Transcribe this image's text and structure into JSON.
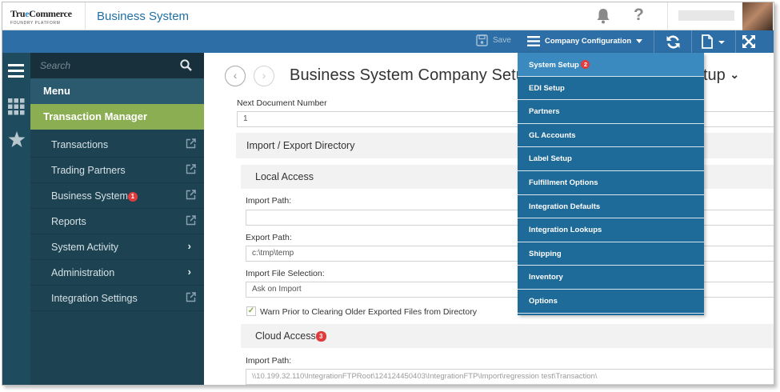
{
  "header": {
    "logo_line1_a": "Tru",
    "logo_line1_o": "e",
    "logo_line1_b": "Commerce",
    "logo_line2": "FOUNDRY PLATFORM",
    "app_title": "Business System"
  },
  "toolbar": {
    "save_label": "Save",
    "company_config_label": "Company Configuration"
  },
  "sidebar": {
    "search_placeholder": "Search",
    "menu_label": "Menu",
    "section_label": "Transaction Manager",
    "items": [
      {
        "label": "Transactions",
        "kind": "external"
      },
      {
        "label": "Trading Partners",
        "kind": "external"
      },
      {
        "label": "Business System",
        "kind": "external",
        "badge": "1"
      },
      {
        "label": "Reports",
        "kind": "external"
      },
      {
        "label": "System Activity",
        "kind": "submenu"
      },
      {
        "label": "Administration",
        "kind": "submenu"
      },
      {
        "label": "Integration Settings",
        "kind": "external"
      }
    ]
  },
  "main": {
    "title": "Business System Company Setup",
    "title_tail": "tup",
    "next_doc_label": "Next Document Number",
    "next_doc_value": "1",
    "import_export_heading": "Import / Export Directory",
    "local_access_heading": "Local Access",
    "import_path_label": "Import Path:",
    "import_path_value": "",
    "export_path_label": "Export Path:",
    "export_path_value": "c:\\tmp\\temp",
    "import_file_selection_label": "Import File Selection:",
    "import_file_selection_value": "Ask on Import",
    "warn_checkbox_label": "Warn Prior to Clearing Older Exported Files from Directory",
    "warn_checked": true,
    "cloud_access_heading": "Cloud Access",
    "cloud_access_badge": "3",
    "cloud_import_path_label": "Import Path:",
    "cloud_import_path_value": "\\\\10.199.32.110\\IntegrationFTPRoot\\124124450403\\IntegrationFTP\\Import\\regression test\\Transaction\\"
  },
  "dropdown": {
    "items": [
      {
        "label": "System Setup",
        "badge": "2",
        "active": true
      },
      {
        "label": "EDI Setup"
      },
      {
        "label": "Partners"
      },
      {
        "label": "GL Accounts"
      },
      {
        "label": "Label Setup"
      },
      {
        "label": "Fulfillment Options"
      },
      {
        "label": "Integration Defaults"
      },
      {
        "label": "Integration Lookups"
      },
      {
        "label": "Shipping"
      },
      {
        "label": "Inventory"
      },
      {
        "label": "Options"
      }
    ]
  },
  "colors": {
    "toolbar_blue": "#2c6ea5",
    "sidebar_dark": "#1d4353",
    "section_green": "#8cae52",
    "dropdown_blue": "#1e6a99",
    "badge_red": "#e23b3b"
  }
}
